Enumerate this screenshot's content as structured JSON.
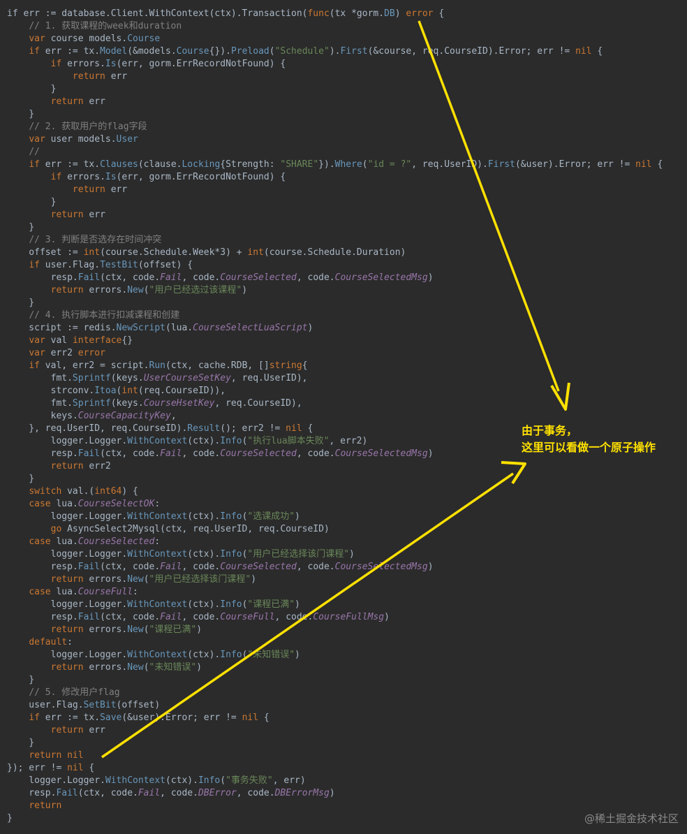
{
  "editor": {
    "colors": {
      "background": "#2b2b2b",
      "text": "#a9b7c6",
      "keyword": "#cc7832",
      "type": "#6897bb",
      "string": "#6a8759",
      "comment": "#808080",
      "constant": "#9876aa",
      "annotation": "#ffe100"
    },
    "lines": [
      [
        [
          "",
          "if err := database.Client.WithContext(ctx).Transaction("
        ],
        [
          "kw",
          "func"
        ],
        [
          "",
          "(tx *gorm."
        ],
        [
          "type",
          "DB"
        ],
        [
          "",
          ") "
        ],
        [
          "kw",
          "error"
        ],
        [
          "",
          " {"
        ]
      ],
      [
        [
          "",
          "    "
        ],
        [
          "cmt",
          "// 1. 获取课程的week和duration"
        ]
      ],
      [
        [
          "",
          "    "
        ],
        [
          "kw",
          "var"
        ],
        [
          "",
          " course models."
        ],
        [
          "type",
          "Course"
        ]
      ],
      [
        [
          "",
          "    "
        ],
        [
          "kw",
          "if"
        ],
        [
          "",
          " err := tx."
        ],
        [
          "type",
          "Model"
        ],
        [
          "",
          "(&models."
        ],
        [
          "type",
          "Course"
        ],
        [
          "",
          "{})."
        ],
        [
          "type",
          "Preload"
        ],
        [
          "",
          "("
        ],
        [
          "str",
          "\"Schedule\""
        ],
        [
          "",
          ")."
        ],
        [
          "type",
          "First"
        ],
        [
          "",
          "(&course, req.CourseID).Error; err != "
        ],
        [
          "kw",
          "nil"
        ],
        [
          "",
          " {"
        ]
      ],
      [
        [
          "",
          "        "
        ],
        [
          "kw",
          "if"
        ],
        [
          "",
          " errors."
        ],
        [
          "type",
          "Is"
        ],
        [
          "",
          "(err, gorm.ErrRecordNotFound) {"
        ]
      ],
      [
        [
          "",
          "            "
        ],
        [
          "kw",
          "return"
        ],
        [
          "",
          " err"
        ]
      ],
      [
        [
          "",
          "        }"
        ]
      ],
      [
        [
          "",
          "        "
        ],
        [
          "kw",
          "return"
        ],
        [
          "",
          " err"
        ]
      ],
      [
        [
          "",
          "    }"
        ]
      ],
      [
        [
          "",
          "    "
        ],
        [
          "cmt",
          "// 2. 获取用户的flag字段"
        ]
      ],
      [
        [
          "",
          "    "
        ],
        [
          "kw",
          "var"
        ],
        [
          "",
          " user models."
        ],
        [
          "type",
          "User"
        ]
      ],
      [
        [
          "",
          "    "
        ],
        [
          "cmt",
          "//"
        ]
      ],
      [
        [
          "",
          "    "
        ],
        [
          "kw",
          "if"
        ],
        [
          "",
          " err := tx."
        ],
        [
          "type",
          "Clauses"
        ],
        [
          "",
          "(clause."
        ],
        [
          "type",
          "Locking"
        ],
        [
          "",
          "{Strength: "
        ],
        [
          "str",
          "\"SHARE\""
        ],
        [
          "",
          "})."
        ],
        [
          "type",
          "Where"
        ],
        [
          "",
          "("
        ],
        [
          "str",
          "\"id = ?\""
        ],
        [
          "",
          ", req.UserID)."
        ],
        [
          "type",
          "First"
        ],
        [
          "",
          "(&user).Error; err != "
        ],
        [
          "kw",
          "nil"
        ],
        [
          "",
          " {"
        ]
      ],
      [
        [
          "",
          "        "
        ],
        [
          "kw",
          "if"
        ],
        [
          "",
          " errors."
        ],
        [
          "type",
          "Is"
        ],
        [
          "",
          "(err, gorm.ErrRecordNotFound) {"
        ]
      ],
      [
        [
          "",
          "            "
        ],
        [
          "kw",
          "return"
        ],
        [
          "",
          " err"
        ]
      ],
      [
        [
          "",
          "        }"
        ]
      ],
      [
        [
          "",
          "        "
        ],
        [
          "kw",
          "return"
        ],
        [
          "",
          " err"
        ]
      ],
      [
        [
          "",
          "    }"
        ]
      ],
      [
        [
          "",
          "    "
        ],
        [
          "cmt",
          "// 3. 判断是否选存在时间冲突"
        ]
      ],
      [
        [
          "",
          "    offset := "
        ],
        [
          "kw",
          "int"
        ],
        [
          "",
          "(course.Schedule.Week*3) + "
        ],
        [
          "kw",
          "int"
        ],
        [
          "",
          "(course.Schedule.Duration)"
        ]
      ],
      [
        [
          "",
          "    "
        ],
        [
          "kw",
          "if"
        ],
        [
          "",
          " user.Flag."
        ],
        [
          "type",
          "TestBit"
        ],
        [
          "",
          "(offset) {"
        ]
      ],
      [
        [
          "",
          "        resp."
        ],
        [
          "type",
          "Fail"
        ],
        [
          "",
          "(ctx, code."
        ],
        [
          "const",
          "Fail"
        ],
        [
          "",
          ", code."
        ],
        [
          "const",
          "CourseSelected"
        ],
        [
          "",
          ", code."
        ],
        [
          "const",
          "CourseSelectedMsg"
        ],
        [
          "",
          ")"
        ]
      ],
      [
        [
          "",
          "        "
        ],
        [
          "kw",
          "return"
        ],
        [
          "",
          " errors."
        ],
        [
          "type",
          "New"
        ],
        [
          "",
          "("
        ],
        [
          "str",
          "\"用户已经选过该课程\""
        ],
        [
          "",
          ")"
        ]
      ],
      [
        [
          "",
          "    }"
        ]
      ],
      [
        [
          "",
          "    "
        ],
        [
          "cmt",
          "// 4. 执行脚本进行扣减课程和创建"
        ]
      ],
      [
        [
          "",
          "    script := redis."
        ],
        [
          "type",
          "NewScript"
        ],
        [
          "",
          "(lua."
        ],
        [
          "const",
          "CourseSelectLuaScript"
        ],
        [
          "",
          ")"
        ]
      ],
      [
        [
          "",
          "    "
        ],
        [
          "kw",
          "var"
        ],
        [
          "",
          " val "
        ],
        [
          "kw",
          "interface"
        ],
        [
          "",
          "{}"
        ]
      ],
      [
        [
          "",
          "    "
        ],
        [
          "kw",
          "var"
        ],
        [
          "",
          " err2 "
        ],
        [
          "kw",
          "error"
        ]
      ],
      [
        [
          "",
          "    "
        ],
        [
          "kw",
          "if"
        ],
        [
          "",
          " val, err2 = script."
        ],
        [
          "type",
          "Run"
        ],
        [
          "",
          "(ctx, cache.RDB, []"
        ],
        [
          "kw",
          "string"
        ],
        [
          "",
          "{"
        ]
      ],
      [
        [
          "",
          "        fmt."
        ],
        [
          "type",
          "Sprintf"
        ],
        [
          "",
          "(keys."
        ],
        [
          "const",
          "UserCourseSetKey"
        ],
        [
          "",
          ", req.UserID),"
        ]
      ],
      [
        [
          "",
          "        strconv."
        ],
        [
          "type",
          "Itoa"
        ],
        [
          "",
          "("
        ],
        [
          "kw",
          "int"
        ],
        [
          "",
          "(req.CourseID)),"
        ]
      ],
      [
        [
          "",
          "        fmt."
        ],
        [
          "type",
          "Sprintf"
        ],
        [
          "",
          "(keys."
        ],
        [
          "const",
          "CourseHsetKey"
        ],
        [
          "",
          ", req.CourseID),"
        ]
      ],
      [
        [
          "",
          "        keys."
        ],
        [
          "const",
          "CourseCapacityKey"
        ],
        [
          "",
          ","
        ]
      ],
      [
        [
          "",
          "    }, req.UserID, req.CourseID)."
        ],
        [
          "type",
          "Result"
        ],
        [
          "",
          "(); err2 != "
        ],
        [
          "kw",
          "nil"
        ],
        [
          "",
          " {"
        ]
      ],
      [
        [
          "",
          "        logger.Logger."
        ],
        [
          "type",
          "WithContext"
        ],
        [
          "",
          "(ctx)."
        ],
        [
          "type",
          "Info"
        ],
        [
          "",
          "("
        ],
        [
          "str",
          "\"执行lua脚本失败\""
        ],
        [
          "",
          ", err2)"
        ]
      ],
      [
        [
          "",
          "        resp."
        ],
        [
          "type",
          "Fail"
        ],
        [
          "",
          "(ctx, code."
        ],
        [
          "const",
          "Fail"
        ],
        [
          "",
          ", code."
        ],
        [
          "const",
          "CourseSelected"
        ],
        [
          "",
          ", code."
        ],
        [
          "const",
          "CourseSelectedMsg"
        ],
        [
          "",
          ")"
        ]
      ],
      [
        [
          "",
          "        "
        ],
        [
          "kw",
          "return"
        ],
        [
          "",
          " err2"
        ]
      ],
      [
        [
          "",
          "    }"
        ]
      ],
      [
        [
          "",
          "    "
        ],
        [
          "kw",
          "switch"
        ],
        [
          "",
          " val.("
        ],
        [
          "kw",
          "int64"
        ],
        [
          "",
          ") {"
        ]
      ],
      [
        [
          "",
          "    "
        ],
        [
          "kw",
          "case"
        ],
        [
          "",
          " lua."
        ],
        [
          "const",
          "CourseSelectOK"
        ],
        [
          "",
          ":"
        ]
      ],
      [
        [
          "",
          "        logger.Logger."
        ],
        [
          "type",
          "WithContext"
        ],
        [
          "",
          "(ctx)."
        ],
        [
          "type",
          "Info"
        ],
        [
          "",
          "("
        ],
        [
          "str",
          "\"选课成功\""
        ],
        [
          "",
          ")"
        ]
      ],
      [
        [
          "",
          "        "
        ],
        [
          "kw",
          "go"
        ],
        [
          "",
          " AsyncSelect2Mysql(ctx, req.UserID, req.CourseID)"
        ]
      ],
      [
        [
          "",
          "    "
        ],
        [
          "kw",
          "case"
        ],
        [
          "",
          " lua."
        ],
        [
          "const",
          "CourseSelected"
        ],
        [
          "",
          ":"
        ]
      ],
      [
        [
          "",
          "        logger.Logger."
        ],
        [
          "type",
          "WithContext"
        ],
        [
          "",
          "(ctx)."
        ],
        [
          "type",
          "Info"
        ],
        [
          "",
          "("
        ],
        [
          "str",
          "\"用户已经选择该门课程\""
        ],
        [
          "",
          ")"
        ]
      ],
      [
        [
          "",
          "        resp."
        ],
        [
          "type",
          "Fail"
        ],
        [
          "",
          "(ctx, code."
        ],
        [
          "const",
          "Fail"
        ],
        [
          "",
          ", code."
        ],
        [
          "const",
          "CourseSelected"
        ],
        [
          "",
          ", code."
        ],
        [
          "const",
          "CourseSelectedMsg"
        ],
        [
          "",
          ")"
        ]
      ],
      [
        [
          "",
          "        "
        ],
        [
          "kw",
          "return"
        ],
        [
          "",
          " errors."
        ],
        [
          "type",
          "New"
        ],
        [
          "",
          "("
        ],
        [
          "str",
          "\"用户已经选择该门课程\""
        ],
        [
          "",
          ")"
        ]
      ],
      [
        [
          "",
          "    "
        ],
        [
          "kw",
          "case"
        ],
        [
          "",
          " lua."
        ],
        [
          "const",
          "CourseFull"
        ],
        [
          "",
          ":"
        ]
      ],
      [
        [
          "",
          "        logger.Logger."
        ],
        [
          "type",
          "WithContext"
        ],
        [
          "",
          "(ctx)."
        ],
        [
          "type",
          "Info"
        ],
        [
          "",
          "("
        ],
        [
          "str",
          "\"课程已满\""
        ],
        [
          "",
          ")"
        ]
      ],
      [
        [
          "",
          "        resp."
        ],
        [
          "type",
          "Fail"
        ],
        [
          "",
          "(ctx, code."
        ],
        [
          "const",
          "Fail"
        ],
        [
          "",
          ", code."
        ],
        [
          "const",
          "CourseFull"
        ],
        [
          "",
          ", code."
        ],
        [
          "const",
          "CourseFullMsg"
        ],
        [
          "",
          ")"
        ]
      ],
      [
        [
          "",
          "        "
        ],
        [
          "kw",
          "return"
        ],
        [
          "",
          " errors."
        ],
        [
          "type",
          "New"
        ],
        [
          "",
          "("
        ],
        [
          "str",
          "\"课程已满\""
        ],
        [
          "",
          ")"
        ]
      ],
      [
        [
          "",
          "    "
        ],
        [
          "kw",
          "default"
        ],
        [
          "",
          ":"
        ]
      ],
      [
        [
          "",
          "        logger.Logger."
        ],
        [
          "type",
          "WithContext"
        ],
        [
          "",
          "(ctx)."
        ],
        [
          "type",
          "Info"
        ],
        [
          "",
          "("
        ],
        [
          "str",
          "\"未知错误\""
        ],
        [
          "",
          ")"
        ]
      ],
      [
        [
          "",
          "        "
        ],
        [
          "kw",
          "return"
        ],
        [
          "",
          " errors."
        ],
        [
          "type",
          "New"
        ],
        [
          "",
          "("
        ],
        [
          "str",
          "\"未知错误\""
        ],
        [
          "",
          ")"
        ]
      ],
      [
        [
          "",
          "    }"
        ]
      ],
      [
        [
          "",
          "    "
        ],
        [
          "cmt",
          "// 5. 修改用户flag"
        ]
      ],
      [
        [
          "",
          "    user.Flag."
        ],
        [
          "type",
          "SetBit"
        ],
        [
          "",
          "(offset)"
        ]
      ],
      [
        [
          "",
          "    "
        ],
        [
          "kw",
          "if"
        ],
        [
          "",
          " err := tx."
        ],
        [
          "type",
          "Save"
        ],
        [
          "",
          "(&user).Error; err != "
        ],
        [
          "kw",
          "nil"
        ],
        [
          "",
          " {"
        ]
      ],
      [
        [
          "",
          "        "
        ],
        [
          "kw",
          "return"
        ],
        [
          "",
          " err"
        ]
      ],
      [
        [
          "",
          "    }"
        ]
      ],
      [
        [
          "",
          "    "
        ],
        [
          "kw",
          "return"
        ],
        [
          "",
          " "
        ],
        [
          "kw",
          "nil"
        ]
      ],
      [
        [
          "",
          "}); err != "
        ],
        [
          "kw",
          "nil"
        ],
        [
          "",
          " {"
        ]
      ],
      [
        [
          "",
          "    logger.Logger."
        ],
        [
          "type",
          "WithContext"
        ],
        [
          "",
          "(ctx)."
        ],
        [
          "type",
          "Info"
        ],
        [
          "",
          "("
        ],
        [
          "str",
          "\"事务失败\""
        ],
        [
          "",
          ", err)"
        ]
      ],
      [
        [
          "",
          "    resp."
        ],
        [
          "type",
          "Fail"
        ],
        [
          "",
          "(ctx, code."
        ],
        [
          "const",
          "Fail"
        ],
        [
          "",
          ", code."
        ],
        [
          "const",
          "DBError"
        ],
        [
          "",
          ", code."
        ],
        [
          "const",
          "DBErrorMsg"
        ],
        [
          "",
          ")"
        ]
      ],
      [
        [
          "",
          "    "
        ],
        [
          "kw",
          "return"
        ]
      ],
      [
        [
          "",
          "}"
        ]
      ]
    ]
  },
  "annotation": {
    "line1": "由于事务，",
    "line2": "这里可以看做一个原子操作"
  },
  "watermark": "@稀土掘金技术社区"
}
